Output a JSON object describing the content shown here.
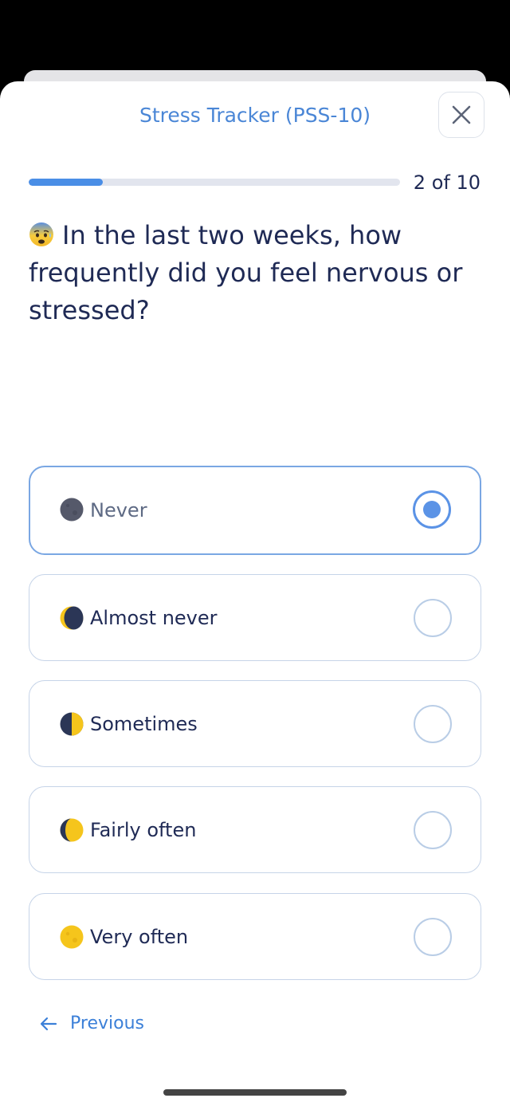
{
  "header": {
    "title": "Stress Tracker (PSS-10)",
    "close_icon": "close-icon"
  },
  "progress": {
    "current": 2,
    "total": 10,
    "label": "2 of 10"
  },
  "question": {
    "emoji": "anxious-face-with-sweat-icon",
    "text": "In the last two weeks, how frequently did you feel nervous or stressed?"
  },
  "options": [
    {
      "label": "Never",
      "icon": "new-moon-icon",
      "selected": true
    },
    {
      "label": "Almost never",
      "icon": "waning-crescent-moon-icon",
      "selected": false
    },
    {
      "label": "Sometimes",
      "icon": "first-quarter-moon-icon",
      "selected": false
    },
    {
      "label": "Fairly often",
      "icon": "waxing-gibbous-moon-icon",
      "selected": false
    },
    {
      "label": "Very often",
      "icon": "full-moon-icon",
      "selected": false
    }
  ],
  "footer": {
    "previous_label": "Previous",
    "previous_icon": "arrow-left-icon"
  },
  "colors": {
    "accent": "#4a86d6",
    "text": "#1f2a55",
    "selected_border": "#7aa7e3",
    "radio_selected": "#5b93e6",
    "moon_dark": "#2b3656",
    "moon_yellow": "#f5c51c"
  }
}
